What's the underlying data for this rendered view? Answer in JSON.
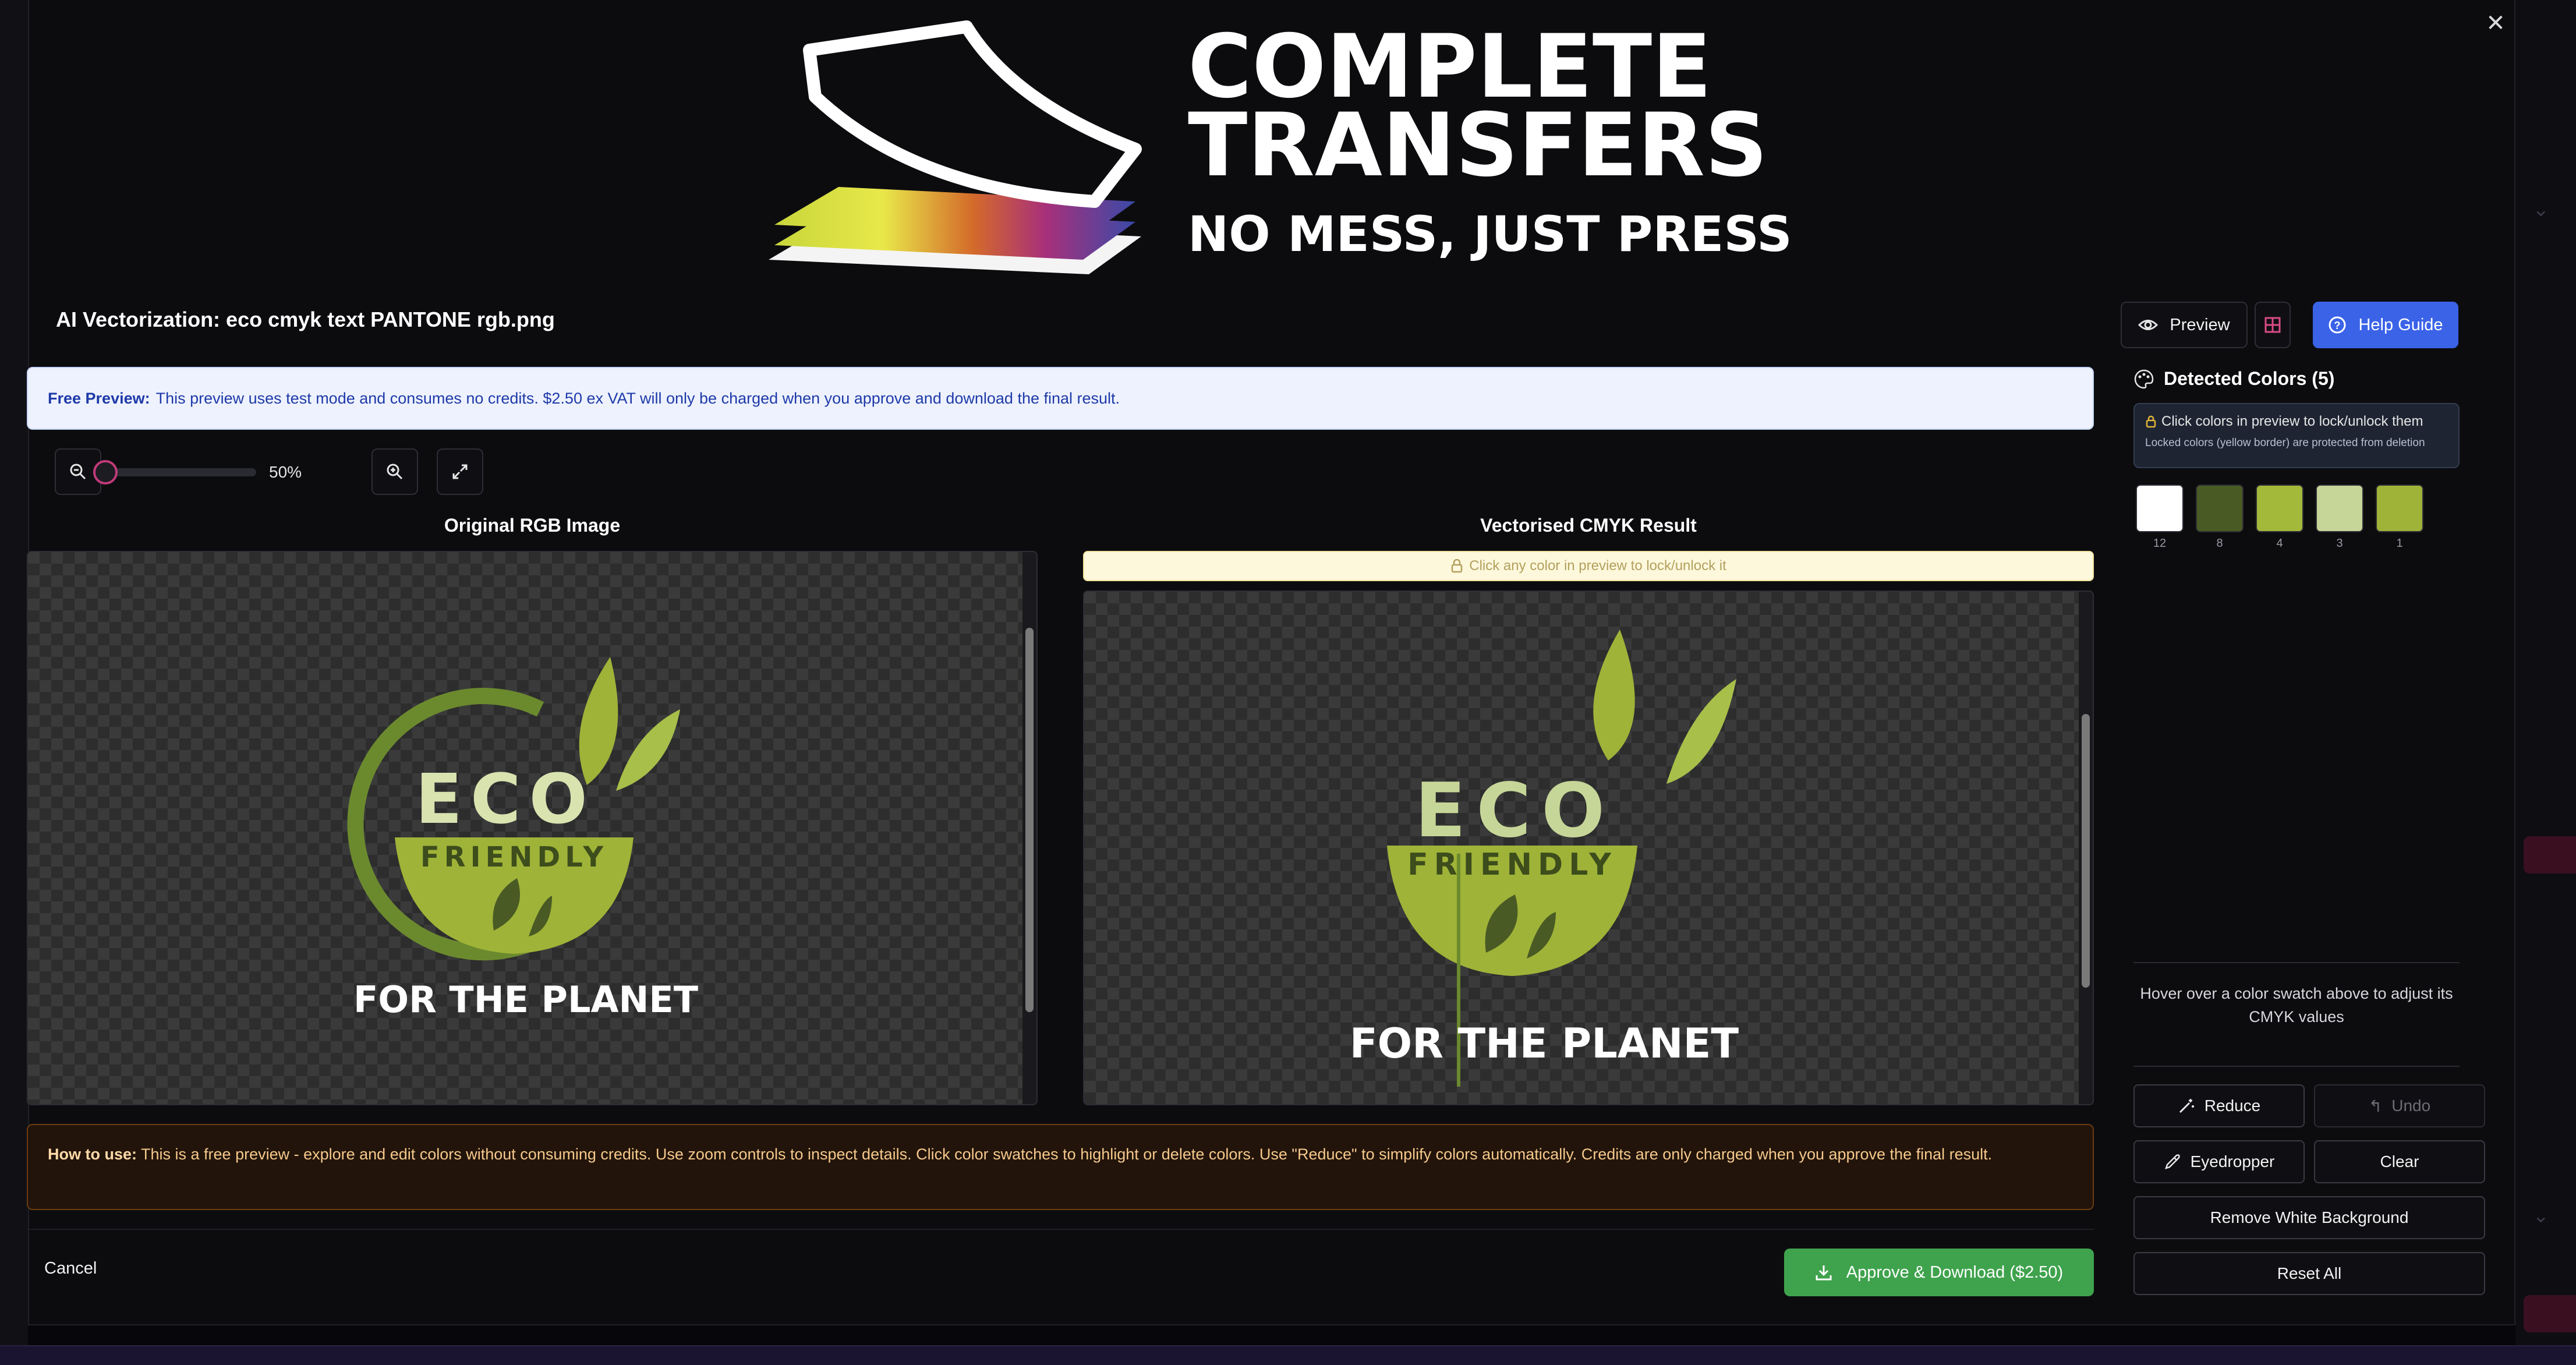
{
  "brand": {
    "line1": "COMPLETE",
    "line2": "TRANSFERS",
    "tagline": "NO MESS, JUST PRESS"
  },
  "dialog": {
    "title": "AI Vectorization: eco cmyk text PANTONE rgb.png",
    "close_icon": "close-icon",
    "preview_label": "Preview",
    "help_label": "Help Guide"
  },
  "info_banner": {
    "lead": "Free Preview:",
    "text": "This preview uses test mode and consumes no credits. $2.50 ex VAT will only be charged when you approve and download the final result."
  },
  "zoom": {
    "value_label": "50%",
    "level": 0.5
  },
  "panes": {
    "original_title": "Original RGB Image",
    "result_title": "Vectorised CMYK Result",
    "lock_hint": "Click any color in preview to lock/unlock it"
  },
  "artwork": {
    "word_eco": "ECO",
    "word_friendly": "FRIENDLY",
    "word_planet": "FOR THE PLANET"
  },
  "how_to": {
    "lead": "How to use:",
    "text": "This is a free preview - explore and edit colors without consuming credits. Use zoom controls to inspect details. Click color swatches to highlight or delete colors. Use \"Reduce\" to simplify colors automatically. Credits are only charged when you approve the final result."
  },
  "footer": {
    "cancel_label": "Cancel",
    "approve_label": "Approve & Download ($2.50)"
  },
  "colors_panel": {
    "title": "Detected Colors (5)",
    "note_line1": "Click colors in preview to lock/unlock them",
    "note_line2": "Locked colors (yellow border) are protected from deletion",
    "swatches": [
      {
        "color": "#ffffff",
        "count": "12"
      },
      {
        "color": "#4a5a24",
        "count": "8"
      },
      {
        "color": "#a3b93a",
        "count": "4"
      },
      {
        "color": "#c6d698",
        "count": "3"
      },
      {
        "color": "#9fb338",
        "count": "1"
      }
    ],
    "hover_hint": "Hover over a color swatch above to adjust its CMYK values",
    "reduce_label": "Reduce",
    "undo_label": "Undo",
    "eyedropper_label": "Eyedropper",
    "clear_label": "Clear",
    "remove_white_label": "Remove White Background",
    "reset_label": "Reset All"
  },
  "theme": {
    "accent_blue": "#3b63e8",
    "accent_green": "#3fa34d",
    "slider_accent": "#c23a7a"
  }
}
